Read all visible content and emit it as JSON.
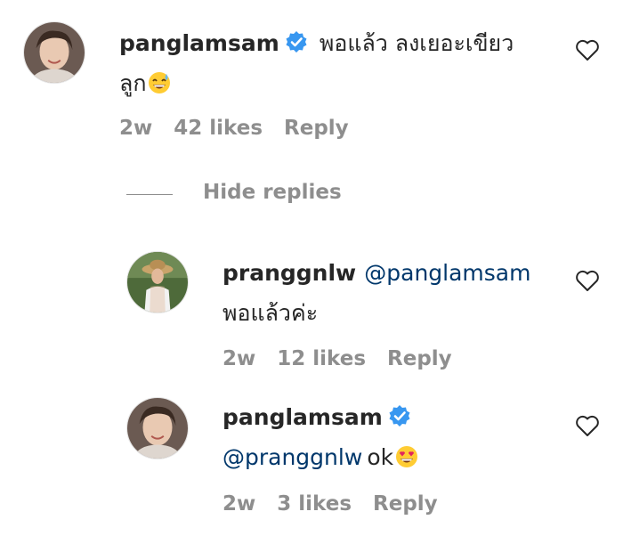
{
  "comments": [
    {
      "username": "panglamsam",
      "verified": true,
      "text_line1": "พอแล้ว ลงเยอะเขียว",
      "text_line2": "ลูก",
      "emoji": "grinning-sweat-emoji",
      "time": "2w",
      "likes": "42 likes",
      "reply": "Reply",
      "hide_replies": "Hide replies",
      "replies": [
        {
          "username": "pranggnlw",
          "mention": "@panglamsam",
          "text": "พอแล้วค่ะ",
          "time": "2w",
          "likes": "12 likes",
          "reply": "Reply"
        },
        {
          "username": "panglamsam",
          "verified": true,
          "mention": "@pranggnlw",
          "text": "ok",
          "emoji": "heart-eyes-emoji",
          "time": "2w",
          "likes": "3 likes",
          "reply": "Reply"
        }
      ]
    }
  ],
  "colors": {
    "text": "#262626",
    "muted": "#8e8e8e",
    "mention": "#00376b",
    "verified": "#3897f0"
  }
}
